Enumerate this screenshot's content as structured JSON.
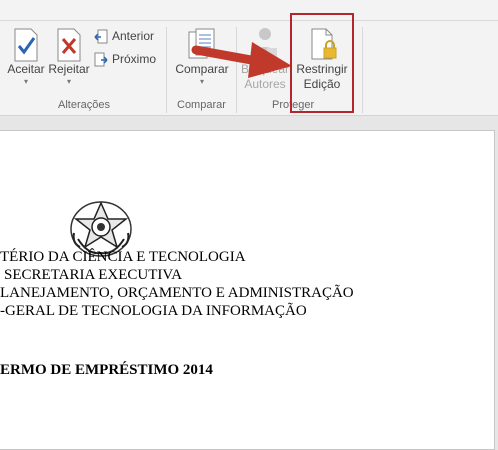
{
  "ribbon": {
    "alteracoes": {
      "group_label": "Alterações",
      "accept_label": "Aceitar",
      "reject_label": "Rejeitar",
      "previous_label": "Anterior",
      "next_label": "Próximo"
    },
    "comparar": {
      "group_label": "Comparar",
      "compare_label": "Comparar"
    },
    "proteger": {
      "group_label": "Proteger",
      "block_authors_line1": "Bloquear",
      "block_authors_line2": "Autores",
      "restrict_line1": "Restringir",
      "restrict_line2": "Edição"
    }
  },
  "document": {
    "lines": [
      "TÉRIO DA CIÊNCIA E TECNOLOGIA",
      "SECRETARIA EXECUTIVA",
      "LANEJAMENTO, ORÇAMENTO E ADMINISTRAÇÃO",
      "-GERAL DE TECNOLOGIA DA INFORMAÇÃO"
    ],
    "title": "ERMO DE EMPRÉSTIMO 2014"
  },
  "colors": {
    "highlight": "#b2262d",
    "arrow": "#c0392b",
    "accept_check": "#2b64b3",
    "reject_x": "#c0392b"
  }
}
